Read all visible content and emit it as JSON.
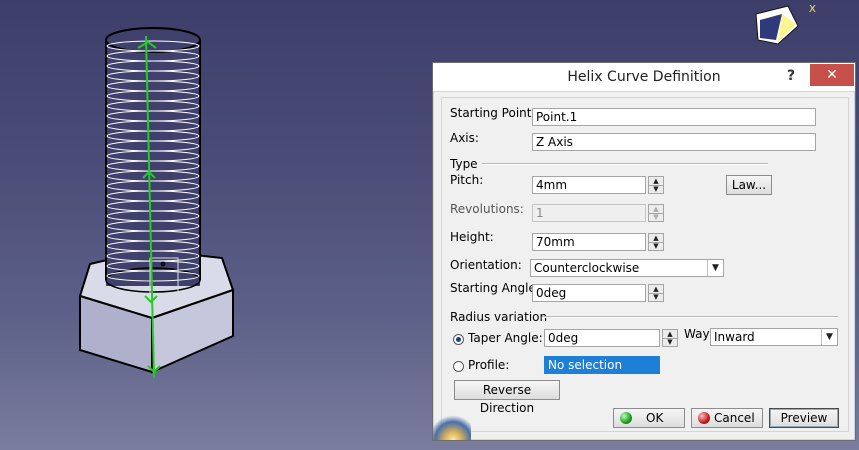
{
  "viewport": {
    "compass_axis_label": "X"
  },
  "dialog": {
    "title": "Helix Curve Definition",
    "help_label": "?",
    "close_label": "✕",
    "starting_point": {
      "label": "Starting Point:",
      "value": "Point.1"
    },
    "axis": {
      "label": "Axis:",
      "value": "Z Axis"
    },
    "type_group": "Type",
    "pitch": {
      "label": "Pitch:",
      "value": "4mm"
    },
    "law_button": "Law...",
    "revolutions": {
      "label": "Revolutions:",
      "value": "1"
    },
    "height": {
      "label": "Height:",
      "value": "70mm"
    },
    "orientation": {
      "label": "Orientation:",
      "value": "Counterclockwise"
    },
    "starting_angle": {
      "label": "Starting Angle:",
      "value": "0deg"
    },
    "radius_group": "Radius variation",
    "taper_angle": {
      "label": "Taper Angle:",
      "value": "0deg",
      "selected": true
    },
    "way": {
      "label": "Way:",
      "value": "Inward"
    },
    "profile": {
      "label": "Profile:",
      "value": "No selection",
      "selected": false
    },
    "reverse_button": "Reverse Direction",
    "ok_button": "OK",
    "cancel_button": "Cancel",
    "preview_button": "Preview"
  },
  "colors": {
    "helix": "#ffffff",
    "axis_line": "#22cc22",
    "selection": "#1e7fd6",
    "close": "#c7504a"
  }
}
